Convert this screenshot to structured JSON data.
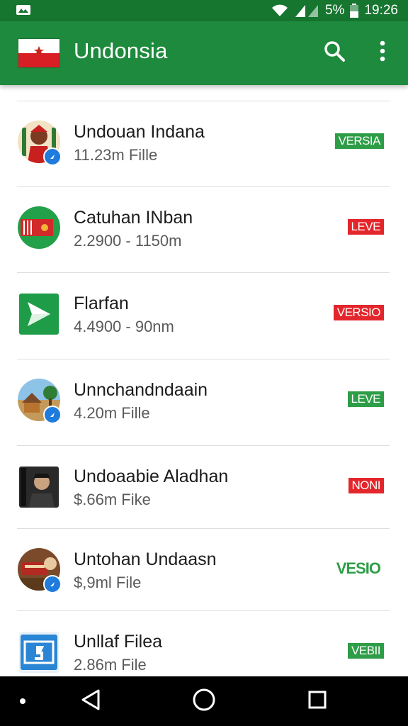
{
  "status_bar": {
    "battery_text": "5%",
    "time": "19:26",
    "icons": [
      "notification-icon",
      "wifi-icon",
      "signal-icon",
      "battery-icon"
    ]
  },
  "app_bar": {
    "title": "Undonsia",
    "icons": [
      "flag-icon",
      "search-icon",
      "more-vert-icon"
    ]
  },
  "list": {
    "items": [
      {
        "title": "Undouan Indana",
        "subtitle": "11.23m Fille",
        "tag": "VERSIA",
        "tag_style": "green"
      },
      {
        "title": "Catuhan INban",
        "subtitle": "2.2900 - 1150m",
        "tag": "LEVE",
        "tag_style": "red"
      },
      {
        "title": "Flarfan",
        "subtitle": "4.4900 - 90nm",
        "tag": "VERSIO",
        "tag_style": "red"
      },
      {
        "title": "Unnchandndaain",
        "subtitle": "4.20m Fille",
        "tag": "LEVE",
        "tag_style": "green"
      },
      {
        "title": "Undoaabie Aladhan",
        "subtitle": "$.66m Fike",
        "tag": "NONI",
        "tag_style": "red"
      },
      {
        "title": "Untohan Undaasn",
        "subtitle": "$,9ml File",
        "tag": "VESIO",
        "tag_style": "plain"
      },
      {
        "title": "Unllaf Filea",
        "subtitle": "2.86m File",
        "tag": "VEBII",
        "tag_style": "green"
      }
    ]
  },
  "colors": {
    "app_bar": "#1e8a3d",
    "status_bar": "#16752f",
    "tag_green": "#2e9d47",
    "tag_red": "#e3262b",
    "badge_blue": "#1f7bdc"
  },
  "nav_bar": {
    "icons": [
      "nav-dot-icon",
      "back-icon",
      "home-icon",
      "recents-icon"
    ]
  }
}
